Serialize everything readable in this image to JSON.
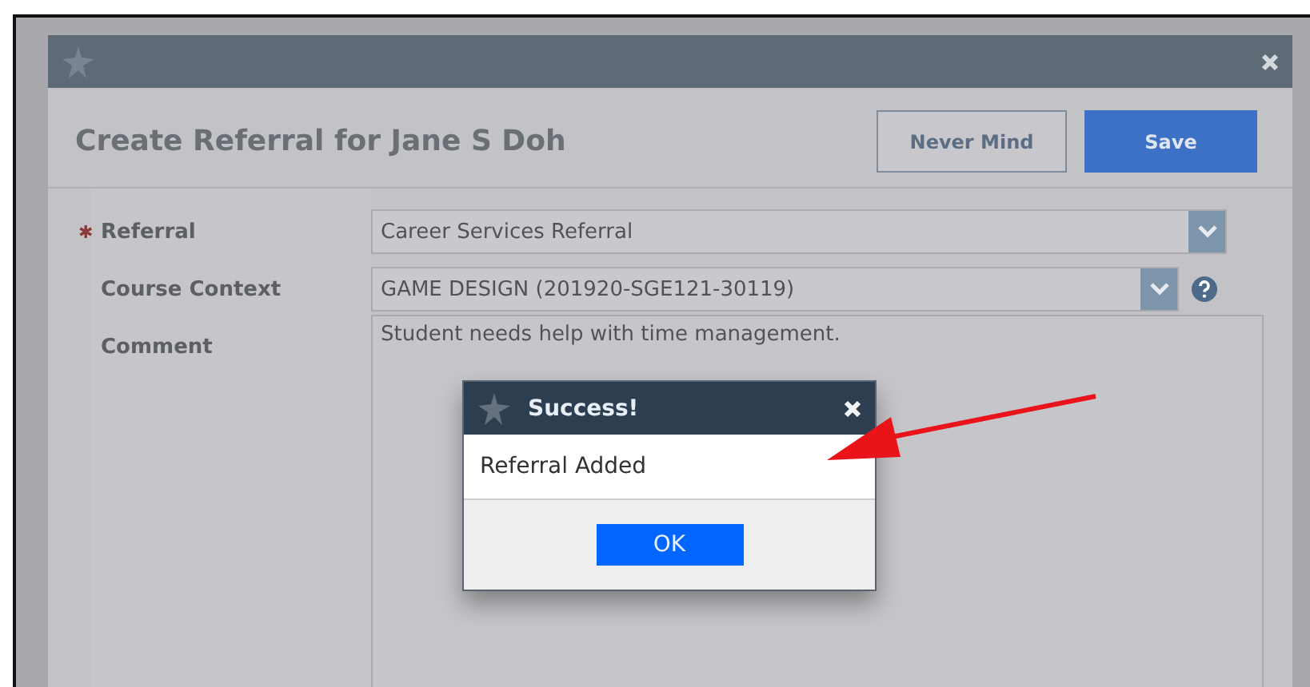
{
  "dialog": {
    "title": "Create Referral for Jane S Doh",
    "buttons": [
      {
        "label": "Never Mind",
        "kind": "secondary"
      },
      {
        "label": "Save",
        "kind": "primary"
      }
    ],
    "fields": [
      {
        "label": "Referral",
        "required_mark": "✱",
        "kind": "select",
        "value": "Career Services Referral",
        "help": false
      },
      {
        "label": "Course Context",
        "kind": "select",
        "value": "GAME DESIGN (201920-SGE121-30119)",
        "help": true
      },
      {
        "label": "Comment",
        "kind": "textarea",
        "value": "Student needs help with time management.",
        "help": false
      }
    ]
  },
  "alert": {
    "title": "Success!",
    "message": "Referral Added",
    "button": "OK"
  }
}
